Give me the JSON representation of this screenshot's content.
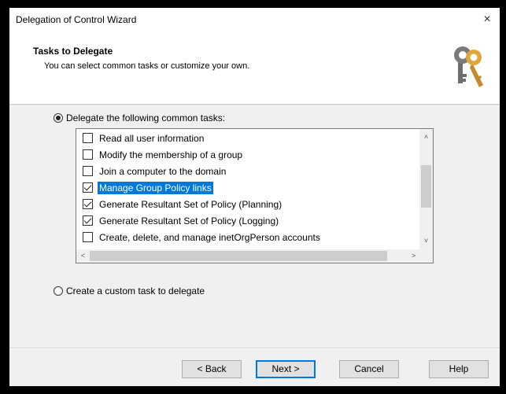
{
  "window": {
    "title": "Delegation of Control Wizard",
    "close_label": "×"
  },
  "header": {
    "title": "Tasks to Delegate",
    "subtitle": "You can select common tasks or customize your own."
  },
  "options": {
    "common_label": "Delegate the following common tasks:",
    "common_selected": true,
    "custom_label": "Create a custom task to delegate",
    "custom_selected": false
  },
  "tasks": [
    {
      "label": "Read all user information",
      "checked": false,
      "selected": false
    },
    {
      "label": "Modify the membership of a group",
      "checked": false,
      "selected": false
    },
    {
      "label": "Join a computer to the domain",
      "checked": false,
      "selected": false
    },
    {
      "label": "Manage Group Policy links",
      "checked": true,
      "selected": true
    },
    {
      "label": "Generate Resultant Set of Policy (Planning)",
      "checked": true,
      "selected": false
    },
    {
      "label": "Generate Resultant Set of Policy (Logging)",
      "checked": true,
      "selected": false
    },
    {
      "label": "Create, delete, and manage inetOrgPerson accounts",
      "checked": false,
      "selected": false
    }
  ],
  "scroll_arrows": {
    "up": "˄",
    "down": "˅",
    "left": "<",
    "right": ">"
  },
  "buttons": {
    "back": "< Back",
    "next": "Next >",
    "cancel": "Cancel",
    "help": "Help"
  }
}
